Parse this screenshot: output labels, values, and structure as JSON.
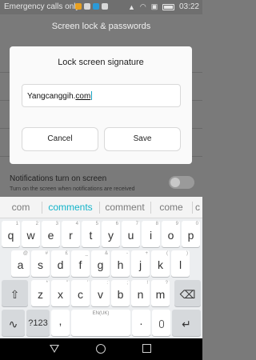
{
  "status_bar": {
    "carrier": "Emergency calls only",
    "time": "03:22"
  },
  "background_screen": {
    "title": "Screen lock & passwords",
    "notifications_title": "Notifications turn on screen",
    "notifications_subtitle": "Turn on the screen when notifications are received"
  },
  "dialog": {
    "title": "Lock screen signature",
    "input_value_prefix": "Yangcanggih.",
    "input_value_underlined": "com",
    "cancel_label": "Cancel",
    "save_label": "Save"
  },
  "keyboard": {
    "suggestions": [
      "com",
      "comments",
      "comment",
      "come",
      "c"
    ],
    "active_suggestion_index": 1,
    "row1": [
      [
        "q",
        "1"
      ],
      [
        "w",
        "2"
      ],
      [
        "e",
        "3"
      ],
      [
        "r",
        "4"
      ],
      [
        "t",
        "5"
      ],
      [
        "y",
        "6"
      ],
      [
        "u",
        "7"
      ],
      [
        "i",
        "8"
      ],
      [
        "o",
        "9"
      ],
      [
        "p",
        "0"
      ]
    ],
    "row2": [
      [
        "a",
        "@"
      ],
      [
        "s",
        "#"
      ],
      [
        "d",
        "£"
      ],
      [
        "f",
        "_"
      ],
      [
        "g",
        "&"
      ],
      [
        "h",
        "-"
      ],
      [
        "j",
        "+"
      ],
      [
        "k",
        "("
      ],
      [
        "l",
        ")"
      ]
    ],
    "row3": [
      [
        "z",
        "*"
      ],
      [
        "x",
        "\""
      ],
      [
        "c",
        "'"
      ],
      [
        "v",
        ":"
      ],
      [
        "b",
        ";"
      ],
      [
        "n",
        "!"
      ],
      [
        "m",
        "?"
      ]
    ],
    "shift_glyph": "⇧",
    "backspace_glyph": "⌫",
    "symbols_label": "?123",
    "comma_label": ",",
    "space_label": "EN(UK)",
    "period_label": ".",
    "enter_glyph": "↵",
    "mic_glyph": "🎤"
  },
  "colors": {
    "accent": "#12b3c9",
    "dialog_bg": "#fafafa",
    "keyboard_bg": "#eceef0"
  }
}
